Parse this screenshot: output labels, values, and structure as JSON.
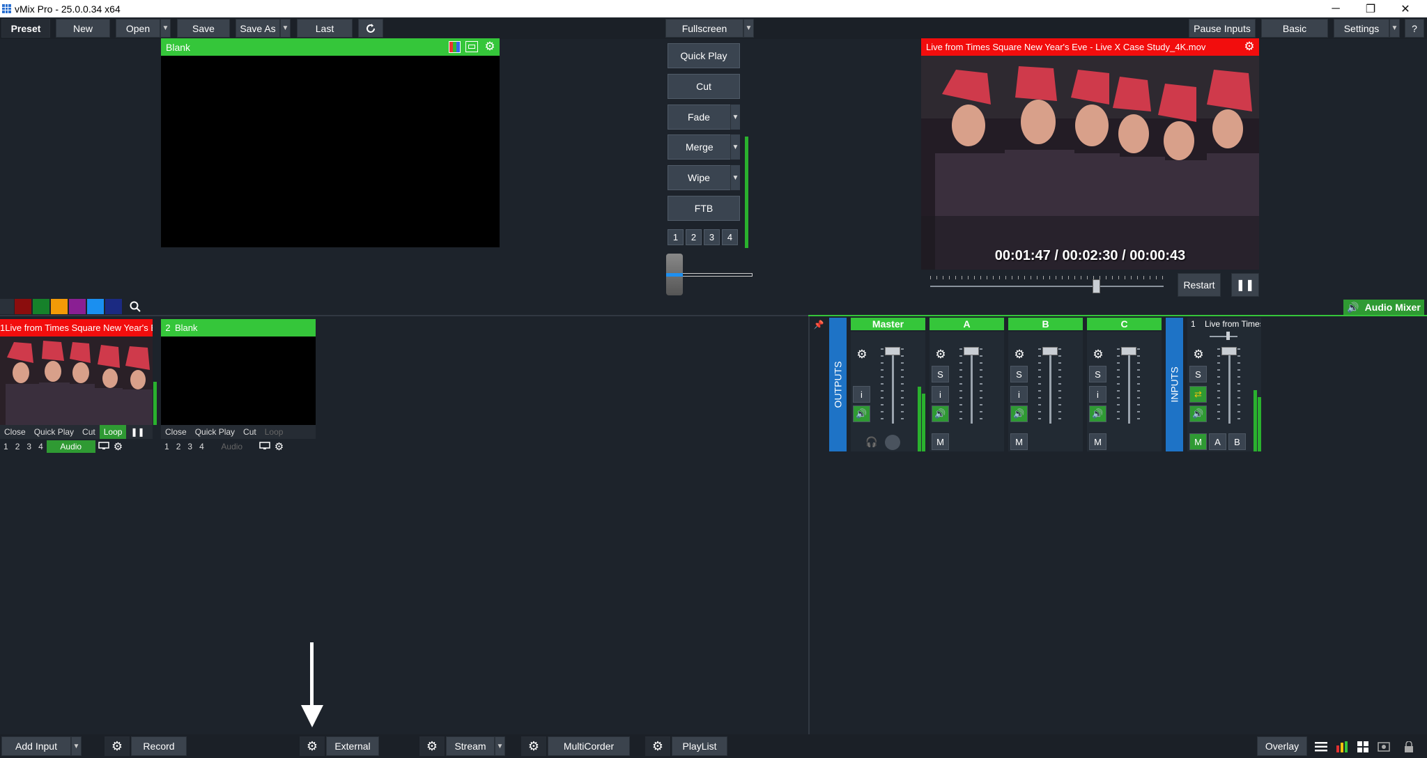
{
  "window": {
    "title": "vMix Pro - 25.0.0.34 x64",
    "minimize": "─",
    "restore": "❐",
    "close": "✕"
  },
  "toolbar": {
    "preset": "Preset",
    "new": "New",
    "open": "Open",
    "save": "Save",
    "save_as": "Save As",
    "last": "Last",
    "fullscreen": "Fullscreen",
    "pause_inputs": "Pause Inputs",
    "basic": "Basic",
    "settings": "Settings",
    "help": "?"
  },
  "preview": {
    "title": "Blank"
  },
  "transitions": {
    "quick_play": "Quick Play",
    "cut": "Cut",
    "fade": "Fade",
    "merge": "Merge",
    "wipe": "Wipe",
    "ftb": "FTB",
    "numbers": [
      "1",
      "2",
      "3",
      "4"
    ]
  },
  "output": {
    "title": "Live from Times Square New Year's Eve - Live X Case Study_4K.mov",
    "time_elapsed": "00:01:47",
    "time_total": "00:02:30",
    "time_remaining": "00:00:43",
    "separator": "/",
    "restart": "Restart",
    "pause": "❚❚",
    "playback_position": 0.71
  },
  "filters": {
    "colors": [
      "#2a313a",
      "#8b0d0d",
      "#16812a",
      "#f39a07",
      "#8a1f93",
      "#1a8ff0",
      "#1b2a82"
    ]
  },
  "inputs": [
    {
      "number": "1",
      "title": "Live from Times Square New Year's E",
      "bar_color": "#f20d0d",
      "controls": [
        "Close",
        "Quick Play",
        "Cut",
        "Loop"
      ],
      "pause": "❚❚",
      "numbers": [
        "1",
        "2",
        "3",
        "4"
      ],
      "audio": "Audio"
    },
    {
      "number": "2",
      "title": "Blank",
      "bar_color": "#35c63a",
      "controls": [
        "Close",
        "Quick Play",
        "Cut",
        "Loop"
      ],
      "numbers": [
        "1",
        "2",
        "3",
        "4"
      ],
      "audio": "Audio"
    }
  ],
  "audio_mixer": {
    "label": "Audio Mixer",
    "outputs_label": "OUTPUTS",
    "inputs_label": "INPUTS",
    "channels": [
      {
        "name": "Master",
        "solo": "",
        "info": "i",
        "mute": ""
      },
      {
        "name": "A",
        "solo": "S",
        "info": "i",
        "mute": "M"
      },
      {
        "name": "B",
        "solo": "S",
        "info": "i",
        "mute": "M"
      },
      {
        "name": "C",
        "solo": "S",
        "info": "i",
        "mute": "M"
      }
    ],
    "input_strip": {
      "number": "1",
      "title": "Live from Times",
      "solo": "S",
      "mute": "M",
      "bus_a": "A",
      "bus_b": "B"
    }
  },
  "bottombar": {
    "add_input": "Add Input",
    "record": "Record",
    "external": "External",
    "stream": "Stream",
    "multicorder": "MultiCorder",
    "playlist": "PlayList",
    "overlay": "Overlay"
  }
}
